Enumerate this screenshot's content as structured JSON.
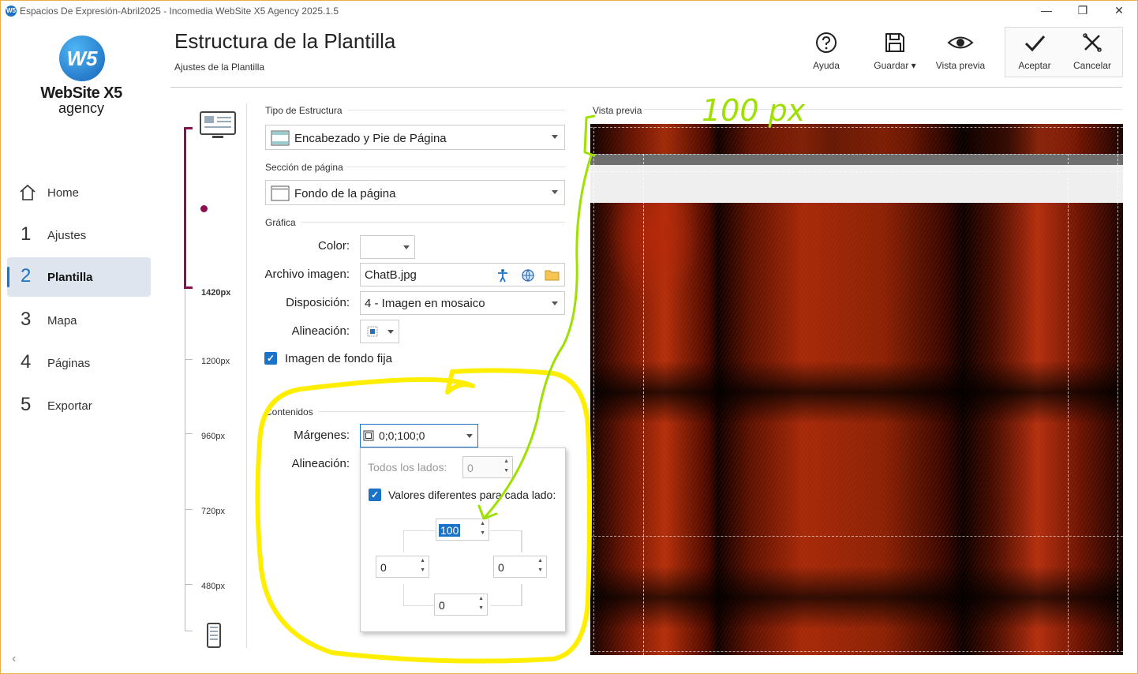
{
  "window": {
    "title": "Espacios De Expresión-Abril2025 - Incomedia WebSite X5 Agency 2025.1.5",
    "icon_text": "W5",
    "minimize": "—",
    "maximize": "❐",
    "close": "✕"
  },
  "logo": {
    "mark": "W5",
    "name": "WebSite X5",
    "sub": "agency"
  },
  "nav": [
    {
      "num": "",
      "label": "Home",
      "icon": "home-icon"
    },
    {
      "num": "1",
      "label": "Ajustes"
    },
    {
      "num": "2",
      "label": "Plantilla",
      "active": true
    },
    {
      "num": "3",
      "label": "Mapa"
    },
    {
      "num": "4",
      "label": "Páginas"
    },
    {
      "num": "5",
      "label": "Exportar"
    }
  ],
  "sidebar_collapse": "‹",
  "header": {
    "title": "Estructura de la Plantilla",
    "subtitle": "Ajustes de la Plantilla"
  },
  "toolbar": {
    "help": "Ayuda",
    "save": "Guardar",
    "preview": "Vista previa",
    "accept": "Aceptar",
    "cancel": "Cancelar"
  },
  "ruler": {
    "labels": [
      "1420px",
      "1200px",
      "960px",
      "720px",
      "480px"
    ],
    "active": "1420px"
  },
  "form": {
    "structure_type_label": "Tipo de Estructura",
    "structure_type_value": "Encabezado y Pie de Página",
    "page_section_label": "Sección de página",
    "page_section_value": "Fondo de la página",
    "graphics_label": "Gráfica",
    "color_label": "Color:",
    "color_value": "",
    "image_file_label": "Archivo imagen:",
    "image_file_value": "ChatB.jpg",
    "layout_label": "Disposición:",
    "layout_value": "4 - Imagen en mosaico",
    "alignment_label": "Alineación:",
    "fixed_bg_label": "Imagen de fondo fija",
    "fixed_bg_checked": true,
    "contents_label": "Contenidos",
    "margins_label": "Márgenes:",
    "margins_value": "0;0;100;0",
    "content_alignment_label": "Alineación:"
  },
  "margins_popup": {
    "all_sides_label": "Todos los lados:",
    "all_sides_value": "0",
    "different_label": "Valores diferentes para cada lado:",
    "different_checked": true,
    "top": "100",
    "left": "0",
    "right": "0",
    "bottom": "0"
  },
  "preview": {
    "label": "Vista previa"
  },
  "annotation": {
    "text": "100 px",
    "color": "#9ee000",
    "highlight_color": "#ffee00"
  }
}
